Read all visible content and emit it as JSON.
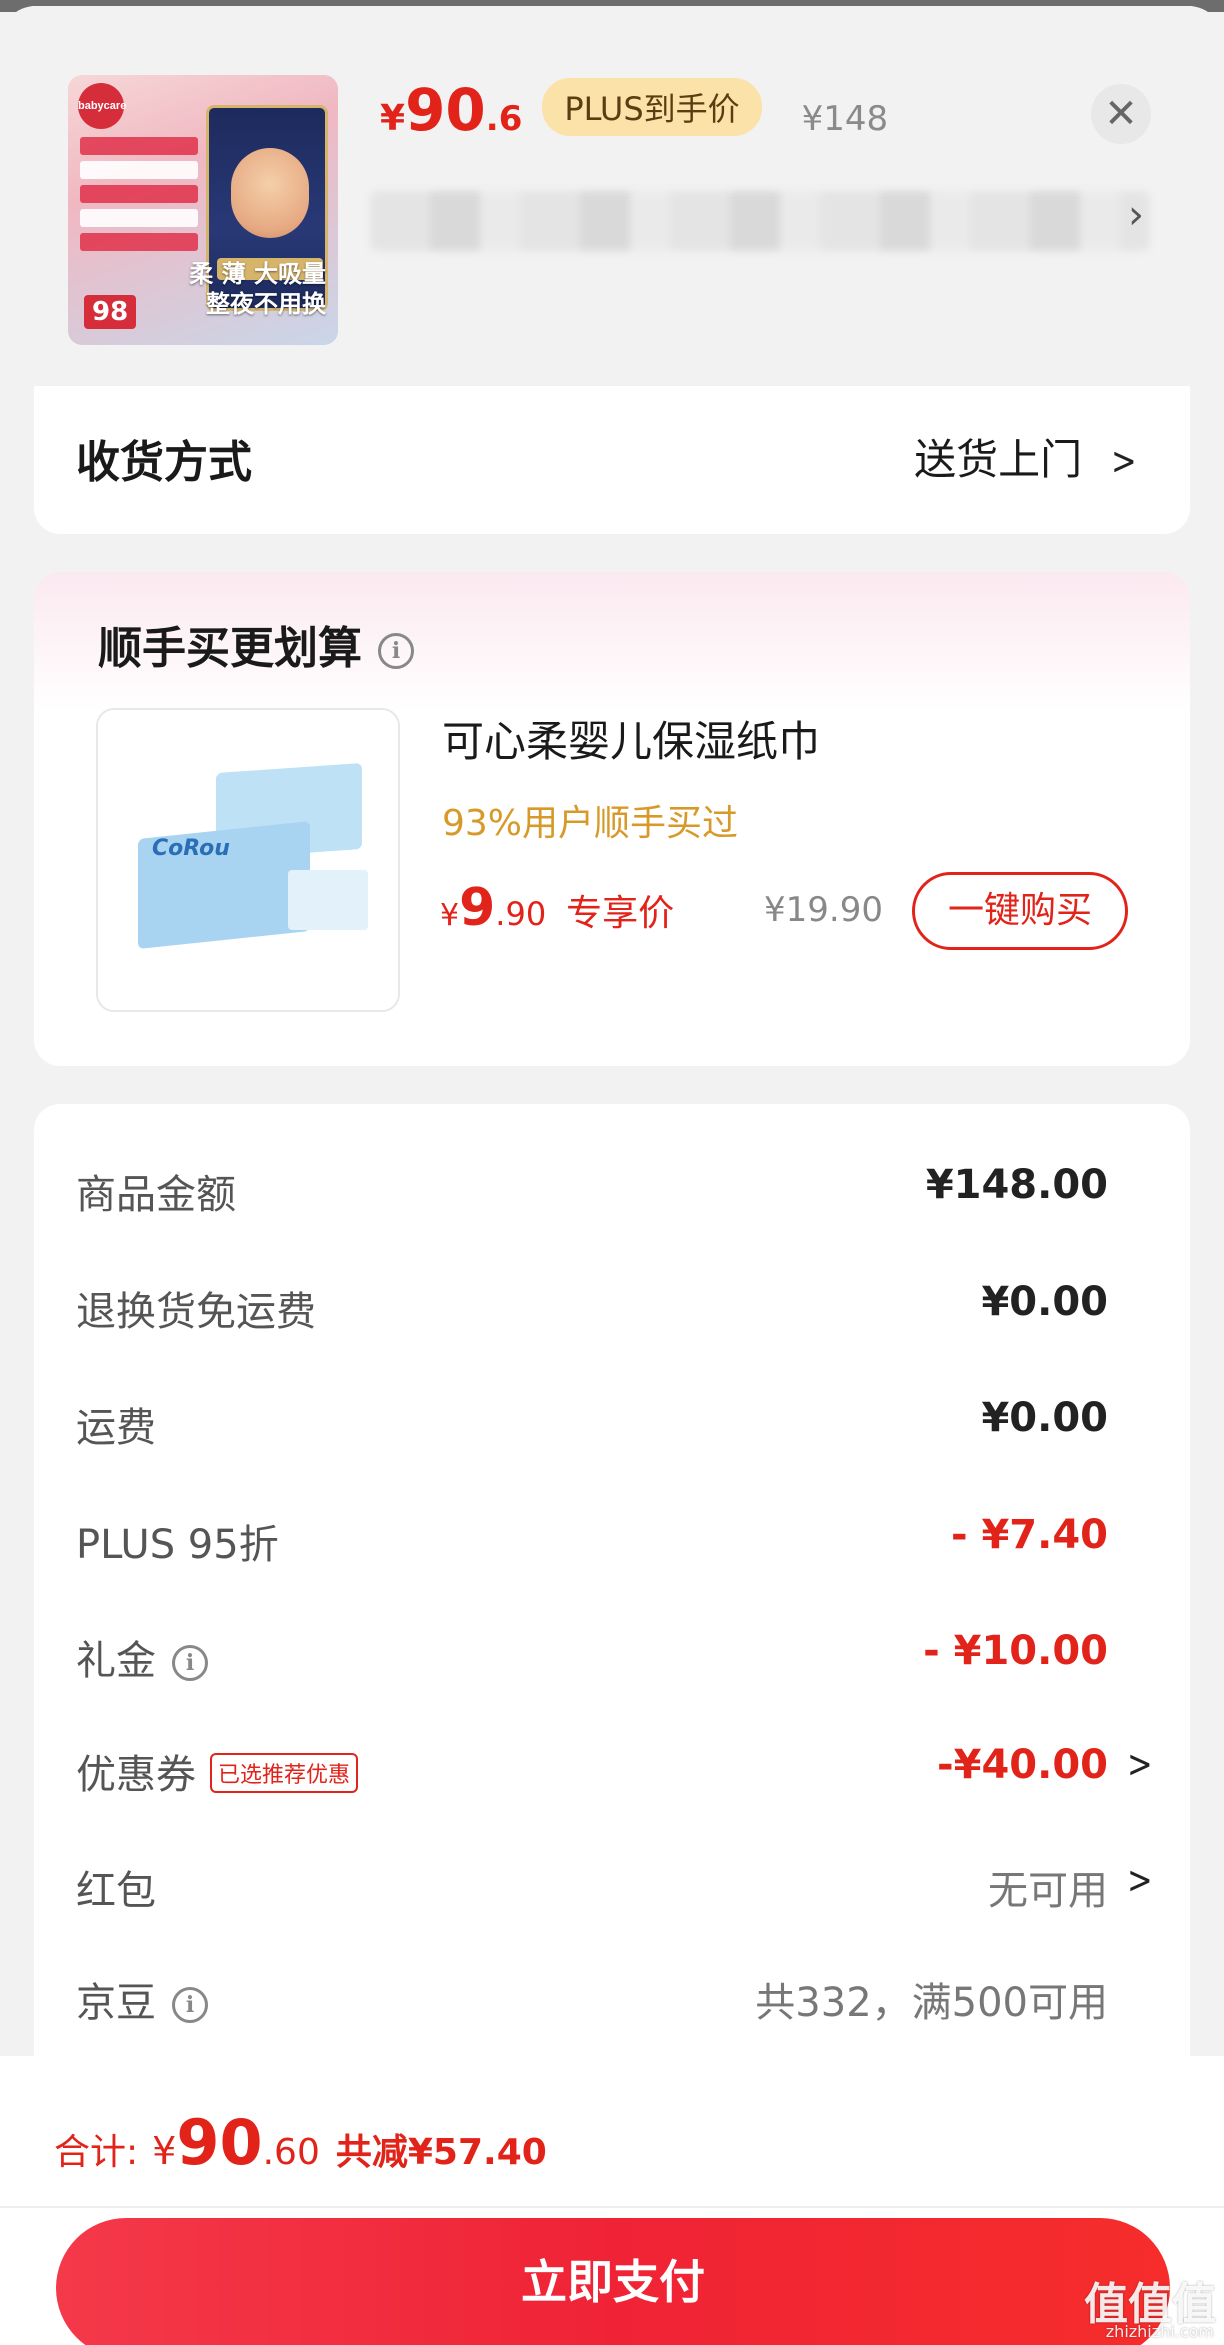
{
  "product": {
    "price_currency": "¥",
    "price_int": "90",
    "price_dec": ".6",
    "plus_badge": "PLUS到手价",
    "original_price": "¥148",
    "image_tagline_line1": "柔 薄 大吸量",
    "image_tagline_line2": "整夜不用换",
    "image_number": "98",
    "image_logo": "babycare"
  },
  "delivery": {
    "label": "收货方式",
    "value": "送货上门"
  },
  "bundle": {
    "title": "顺手买更划算",
    "item_name": "可心柔婴儿保湿纸巾",
    "item_tag": "93%用户顺手买过",
    "price_currency": "¥",
    "price_int": "9",
    "price_dec": ".90",
    "exclusive_label": "专享价",
    "original_price": "¥19.90",
    "buy_button": "一键购买",
    "image_brand": "CoRou"
  },
  "summary": {
    "rows": [
      {
        "label": "商品金额",
        "value": "¥148.00"
      },
      {
        "label": "退换货免运费",
        "value": "¥0.00"
      },
      {
        "label": "运费",
        "value": "¥0.00"
      },
      {
        "label": "PLUS 95折",
        "value": "- ¥7.40"
      },
      {
        "label": "礼金",
        "value": "- ¥10.00"
      },
      {
        "label": "优惠券",
        "tag": "已选推荐优惠",
        "value": "-¥40.00"
      },
      {
        "label": "红包",
        "value": "无可用"
      },
      {
        "label": "京豆",
        "value": "共332，满500可用"
      }
    ]
  },
  "footer": {
    "total_label": "合计:",
    "total_currency": "¥",
    "total_int": "90",
    "total_dec": ".60",
    "total_saved": "共减¥57.40",
    "pay_button": "立即支付"
  },
  "watermark": {
    "main": "值值值",
    "sub": "zhizhizhi.com"
  },
  "colors": {
    "accent_red": "#e2231a",
    "plus_gold": "#fbe2a8",
    "tag_gold": "#d79a2a"
  }
}
